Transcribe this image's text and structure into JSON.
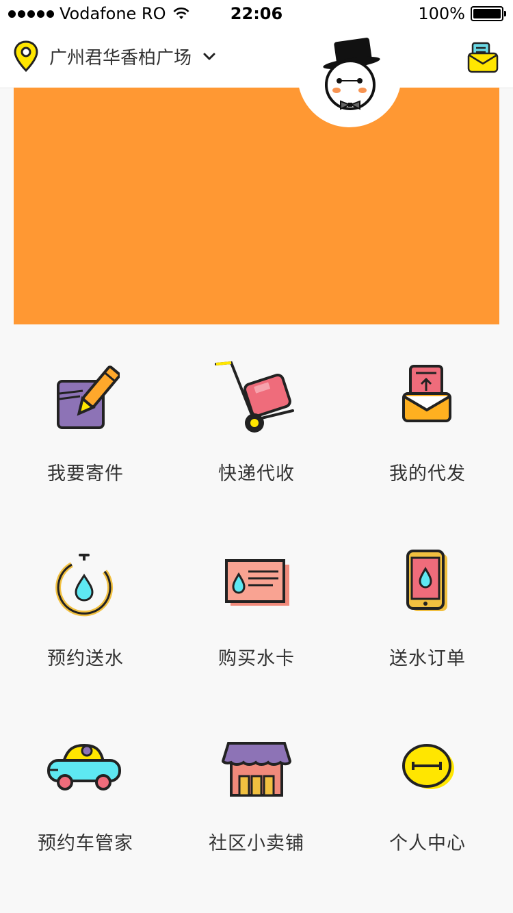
{
  "status_bar": {
    "carrier": "Vodafone RO",
    "time": "22:06",
    "battery": "100%"
  },
  "header": {
    "location": "广州君华香柏广场",
    "location_icon": "map-pin-icon",
    "dropdown_icon": "chevron-down-icon",
    "message_icon": "envelope-icon"
  },
  "banner": {
    "color": "#ff9833",
    "page_count": 4,
    "active_page": 1
  },
  "services": [
    {
      "label": "我要寄件",
      "icon": "pencil-notepad-icon"
    },
    {
      "label": "快递代收",
      "icon": "hand-truck-icon"
    },
    {
      "label": "我的代发",
      "icon": "outgoing-envelope-icon"
    },
    {
      "label": "预约送水",
      "icon": "stopwatch-water-icon"
    },
    {
      "label": "购买水卡",
      "icon": "water-card-icon"
    },
    {
      "label": "送水订单",
      "icon": "phone-water-icon"
    },
    {
      "label": "预约车管家",
      "icon": "car-icon"
    },
    {
      "label": "社区小卖铺",
      "icon": "shop-icon"
    },
    {
      "label": "个人中心",
      "icon": "user-center-icon"
    }
  ],
  "colors": {
    "accent_orange": "#ff9833",
    "accent_yellow": "#ffe600",
    "purple": "#8d73b6",
    "pink": "#f07b7b",
    "cyan": "#5ee8f2"
  }
}
